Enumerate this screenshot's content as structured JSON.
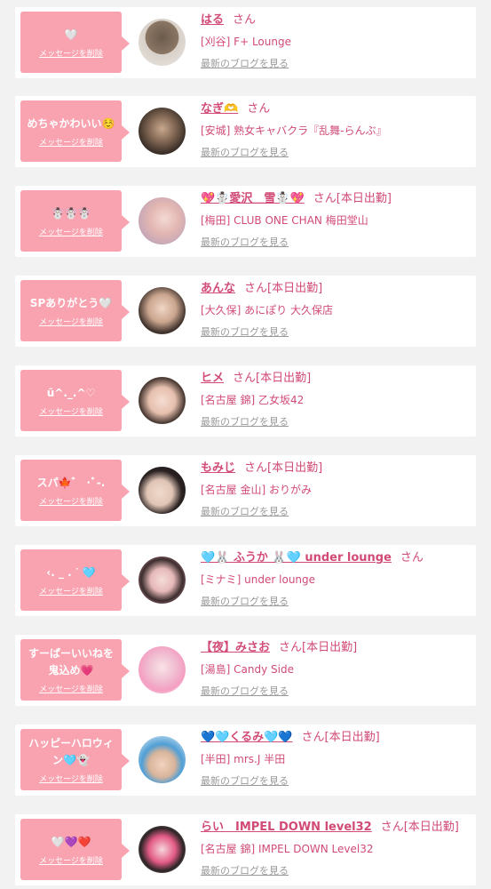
{
  "colors": {
    "bubble": "#f9a3b0",
    "accent": "#d14b76",
    "muted": "#9a9a9a",
    "background": "#f3f2f2"
  },
  "items": [
    {
      "message": "🤍",
      "delete_label": "メッセージを削除",
      "name": "はる",
      "suffix": "さん",
      "shop": "[刈谷] F+ Lounge",
      "blog_link": "最新のブログを見る",
      "avatar_icon": "profile-photo"
    },
    {
      "message": "めちゃかわいい☺️",
      "delete_label": "メッセージを削除",
      "name": "なぎ🫶",
      "suffix": "さん",
      "shop": "[安城] 熟女キャバクラ『乱舞-らんぶ』",
      "blog_link": "最新のブログを見る",
      "avatar_icon": "profile-photo"
    },
    {
      "message": "☃️☃️☃️",
      "delete_label": "メッセージを削除",
      "name": "💖☃️愛沢＿雪☃️💖",
      "suffix": "さん[本日出勤]",
      "shop": "[梅田] CLUB ONE CHAN 梅田堂山",
      "blog_link": "最新のブログを見る",
      "avatar_icon": "profile-photo"
    },
    {
      "message": "SPありがとう🤍",
      "delete_label": "メッセージを削除",
      "name": "あんな",
      "suffix": "さん[本日出勤]",
      "shop": "[大久保] あにぽり 大久保店",
      "blog_link": "最新のブログを見る",
      "avatar_icon": "profile-photo"
    },
    {
      "message": "ũ^._.^♡",
      "delete_label": "メッセージを削除",
      "name": "ヒメ",
      "suffix": "さん[本日出勤]",
      "shop": "[名古屋 錦] 乙女坂42",
      "blog_link": "最新のブログを見る",
      "avatar_icon": "profile-photo"
    },
    {
      "message": "スパ🍁゛ ･ﾞ-.",
      "delete_label": "メッセージを削除",
      "name": "もみじ",
      "suffix": "さん[本日出勤]",
      "shop": "[名古屋 金山] おりがみ",
      "blog_link": "最新のブログを見る",
      "avatar_icon": "profile-photo"
    },
    {
      "message": "‹. _ . ᐝ 🩵",
      "delete_label": "メッセージを削除",
      "name": "🩵🐰 ふうか 🐰🩵 under lounge",
      "suffix": "さん",
      "shop": "[ミナミ] under lounge",
      "blog_link": "最新のブログを見る",
      "avatar_icon": "profile-photo"
    },
    {
      "message": "すーぱーいいねを\n鬼込め💗",
      "delete_label": "メッセージを削除",
      "name": "【夜】みさお",
      "suffix": "さん[本日出勤]",
      "shop": "[湯島] Candy Side",
      "blog_link": "最新のブログを見る",
      "avatar_icon": "profile-photo"
    },
    {
      "message": "ハッピーハロウィ\nン🩵👻",
      "delete_label": "メッセージを削除",
      "name": "💙🩵くるみ🩵💙",
      "suffix": "さん[本日出勤]",
      "shop": "[半田] mrs.J 半田",
      "blog_link": "最新のブログを見る",
      "avatar_icon": "profile-photo"
    },
    {
      "message": "🤍💜❤️",
      "delete_label": "メッセージを削除",
      "name": "らい　IMPEL DOWN level32",
      "suffix": "さん[本日出勤]",
      "shop": "[名古屋 錦] IMPEL DOWN Level32",
      "blog_link": "最新のブログを見る",
      "avatar_icon": "profile-photo"
    }
  ]
}
